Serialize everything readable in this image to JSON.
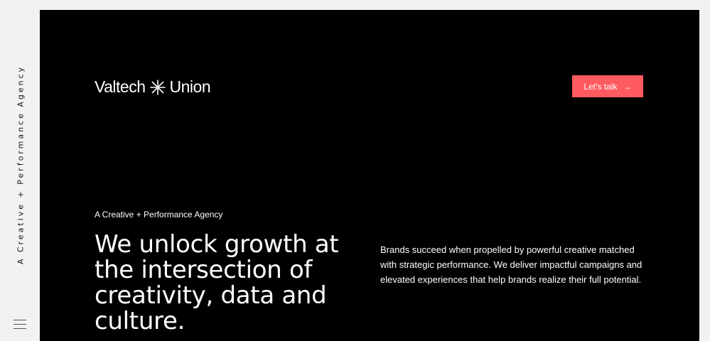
{
  "sidebar": {
    "tagline": "A Creative + Performance Agency",
    "menu_icon": "hamburger-menu-icon"
  },
  "header": {
    "logo_left": "Valtech",
    "logo_icon": "asterisk-star-icon",
    "logo_right": "Union",
    "cta_label": "Let's talk",
    "cta_icon": "arrow-right-icon",
    "cta_arrow": "→"
  },
  "hero": {
    "eyebrow": "A Creative + Performance Agency",
    "headline": "We unlock growth at the intersection of creativity, data and culture.",
    "description": "Brands succeed when propelled by powerful creative matched with strategic performance. We deliver impactful campaigns and elevated experiences that help brands realize their full potential."
  },
  "colors": {
    "background": "#000000",
    "frame": "#f2f2f2",
    "accent": "#ff5a5f",
    "text": "#ffffff"
  }
}
